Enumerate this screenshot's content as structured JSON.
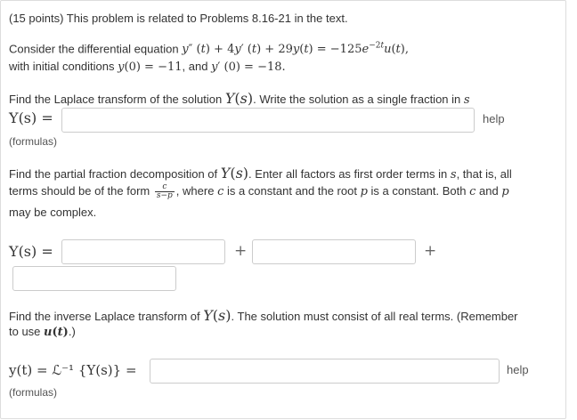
{
  "problem": {
    "header": "(15 points) This problem is related to Problems 8.16-21 in the text.",
    "intro": "Consider the differential equation",
    "ic_prefix": "with initial conditions",
    "ic_and": ", and"
  },
  "part1": {
    "instruction": "Find the Laplace transform of the solution",
    "instruction_suffix": ". Write the solution as a single fraction in",
    "label": "Y(s) =",
    "input_value": "",
    "help": "help",
    "formulas": "(formulas)"
  },
  "part2": {
    "instruction_a": "Find the partial fraction decomposition of",
    "instruction_b": ". Enter all factors as first order terms in",
    "instruction_c": ", that is, all",
    "instruction_d": "terms should be of the form",
    "instruction_e": ", where",
    "instruction_f": "is a constant and the root",
    "instruction_g": "is a constant. Both",
    "instruction_h": "and",
    "instruction_i": "may be complex.",
    "label": "Y(s) =",
    "plus": "+",
    "input1_value": "",
    "input2_value": "",
    "input3_value": ""
  },
  "part3": {
    "instruction_a": "Find the inverse Laplace transform of",
    "instruction_b": ". The solution must consist of all real terms. (Remember",
    "instruction_c": "to use",
    "instruction_d": ".)",
    "label": "y(t) = ℒ⁻¹ {Y(s)} =",
    "input_value": "",
    "help": "help",
    "formulas": "(formulas)"
  }
}
